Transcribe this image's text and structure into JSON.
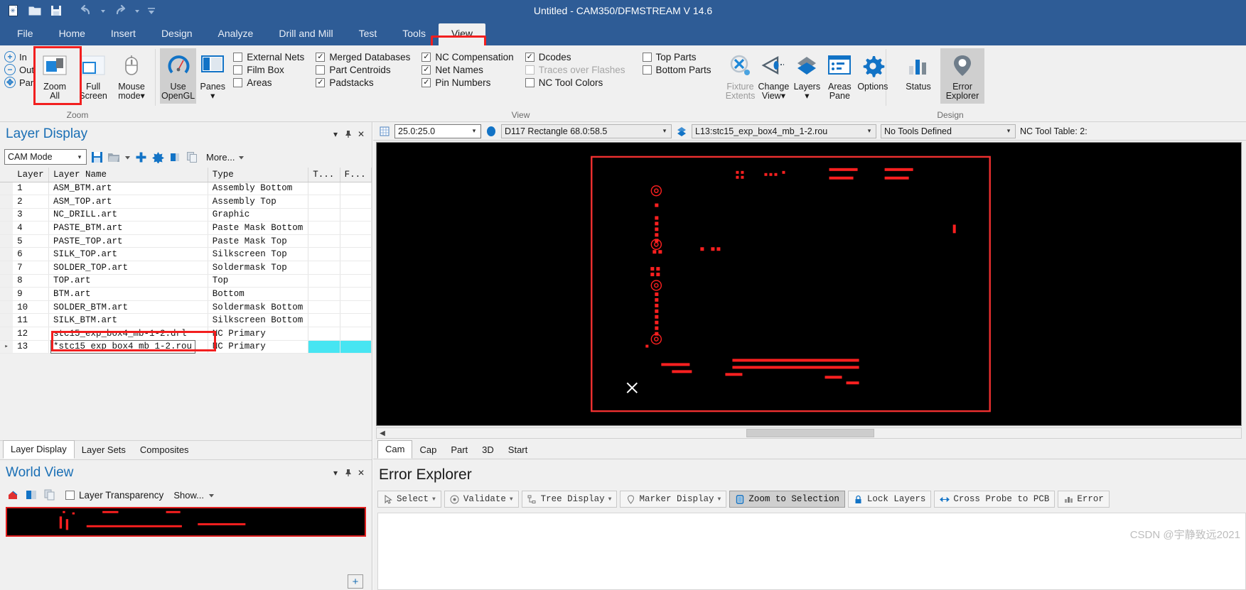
{
  "window": {
    "title": "Untitled - CAM350/DFMSTREAM V 14.6"
  },
  "quick_access": {
    "items": [
      {
        "name": "new-document-icon",
        "glyph": "new"
      },
      {
        "name": "open-folder-icon",
        "glyph": "open"
      },
      {
        "name": "save-icon",
        "glyph": "save"
      },
      {
        "name": "undo-icon",
        "glyph": "undo"
      },
      {
        "name": "undo-dropdown-icon",
        "glyph": "caret"
      },
      {
        "name": "redo-icon",
        "glyph": "redo"
      },
      {
        "name": "redo-dropdown-icon",
        "glyph": "caret"
      },
      {
        "name": "customize-qat-icon",
        "glyph": "caret"
      }
    ]
  },
  "ribbon_tabs": [
    {
      "label": "File",
      "active": false
    },
    {
      "label": "Home",
      "active": false
    },
    {
      "label": "Insert",
      "active": false
    },
    {
      "label": "Design",
      "active": false
    },
    {
      "label": "Analyze",
      "active": false
    },
    {
      "label": "Drill and Mill",
      "active": false
    },
    {
      "label": "Test",
      "active": false
    },
    {
      "label": "Tools",
      "active": false
    },
    {
      "label": "View",
      "active": true
    }
  ],
  "ribbon": {
    "zoom_group": {
      "label": "Zoom",
      "small_items": [
        {
          "label": "In",
          "icon": "zoom-in-icon"
        },
        {
          "label": "Out",
          "icon": "zoom-out-icon"
        },
        {
          "label": "Pan",
          "icon": "pan-icon"
        }
      ],
      "buttons": [
        {
          "label": "Zoom\nAll",
          "icon": "zoom-all-icon",
          "highlighted": true
        },
        {
          "label": "Full\nScreen",
          "icon": "full-screen-icon",
          "highlighted": false
        },
        {
          "label": "Mouse\nmode▾",
          "icon": "mouse-mode-icon",
          "highlighted": false
        }
      ]
    },
    "view_group": {
      "label": "View",
      "buttons": [
        {
          "label": "Use\nOpenGL",
          "icon": "opengl-icon",
          "selected": true
        },
        {
          "label": "Panes\n▾",
          "icon": "panes-icon",
          "selected": false
        }
      ],
      "checkbox_columns": [
        [
          {
            "label": "External Nets",
            "checked": false,
            "disabled": false
          },
          {
            "label": "Film Box",
            "checked": false,
            "disabled": false
          },
          {
            "label": "Areas",
            "checked": false,
            "disabled": false
          }
        ],
        [
          {
            "label": "Merged Databases",
            "checked": true,
            "disabled": false
          },
          {
            "label": "Part Centroids",
            "checked": false,
            "disabled": false
          },
          {
            "label": "Padstacks",
            "checked": true,
            "disabled": false
          }
        ],
        [
          {
            "label": "NC Compensation",
            "checked": true,
            "disabled": false
          },
          {
            "label": "Net Names",
            "checked": true,
            "disabled": false
          },
          {
            "label": "Pin Numbers",
            "checked": true,
            "disabled": false
          }
        ],
        [
          {
            "label": "Dcodes",
            "checked": true,
            "disabled": false
          },
          {
            "label": "Traces over Flashes",
            "checked": false,
            "disabled": true
          },
          {
            "label": "NC Tool Colors",
            "checked": false,
            "disabled": false
          }
        ],
        [
          {
            "label": "Top Parts",
            "checked": false,
            "disabled": false
          },
          {
            "label": "Bottom Parts",
            "checked": false,
            "disabled": false
          }
        ]
      ],
      "big_buttons": [
        {
          "label": "Fixture\nExtents",
          "icon": "fixture-extents-icon",
          "disabled": true
        },
        {
          "label": "Change\nView▾",
          "icon": "change-view-icon",
          "disabled": false
        },
        {
          "label": "Layers\n▾",
          "icon": "layers-icon",
          "disabled": false
        },
        {
          "label": "Areas\nPane",
          "icon": "areas-pane-icon",
          "disabled": false
        },
        {
          "label": "Options",
          "icon": "options-gear-icon",
          "disabled": false
        }
      ]
    },
    "design_group": {
      "label": "Design",
      "buttons": [
        {
          "label": "Status",
          "icon": "status-chart-icon",
          "selected": false
        },
        {
          "label": "Error\nExplorer",
          "icon": "error-explorer-pin-icon",
          "selected": true
        }
      ]
    }
  },
  "doc_toolbar": {
    "grid_icon": "grid-icon",
    "grid_value": "25.0:25.0",
    "dcode_icon": "dcode-icon",
    "dcode_value": "D117 Rectangle 68.0:58.5",
    "layer_icon": "layer-icon",
    "layer_value": "L13:stc15_exp_box4_mb_1-2.rou",
    "tools_value": "No Tools Defined",
    "nc_tool_table": "NC Tool Table: 2:"
  },
  "layer_display": {
    "title": "Layer Display",
    "panel_buttons": [
      {
        "name": "collapse-icon",
        "glyph": "▾"
      },
      {
        "name": "pin-icon",
        "glyph": "📌"
      },
      {
        "name": "close-icon",
        "glyph": "✕"
      }
    ],
    "mode": "CAM Mode",
    "toolbar_icons": [
      {
        "name": "save-layers-icon"
      },
      {
        "name": "open-layers-icon"
      },
      {
        "name": "open-layers-dropdown-icon"
      },
      {
        "name": "add-layer-icon"
      },
      {
        "name": "delete-layer-icon"
      },
      {
        "name": "import-layer-icon"
      },
      {
        "name": "copy-layer-icon"
      }
    ],
    "more_label": "More...",
    "columns": [
      "Layer",
      "Layer Name",
      "Type",
      "T...",
      "F..."
    ],
    "rows": [
      {
        "num": "1",
        "name": "ASM_BTM.art",
        "type": "Assembly Bottom",
        "t": "",
        "f": ""
      },
      {
        "num": "2",
        "name": "ASM_TOP.art",
        "type": "Assembly Top",
        "t": "",
        "f": ""
      },
      {
        "num": "3",
        "name": "NC_DRILL.art",
        "type": "Graphic",
        "t": "",
        "f": ""
      },
      {
        "num": "4",
        "name": "PASTE_BTM.art",
        "type": "Paste Mask Bottom",
        "t": "",
        "f": ""
      },
      {
        "num": "5",
        "name": "PASTE_TOP.art",
        "type": "Paste Mask Top",
        "t": "",
        "f": ""
      },
      {
        "num": "6",
        "name": "SILK_TOP.art",
        "type": "Silkscreen Top",
        "t": "",
        "f": ""
      },
      {
        "num": "7",
        "name": "SOLDER_TOP.art",
        "type": "Soldermask Top",
        "t": "",
        "f": ""
      },
      {
        "num": "8",
        "name": "TOP.art",
        "type": "Top",
        "t": "",
        "f": ""
      },
      {
        "num": "9",
        "name": "BTM.art",
        "type": "Bottom",
        "t": "",
        "f": ""
      },
      {
        "num": "10",
        "name": "SOLDER_BTM.art",
        "type": "Soldermask Bottom",
        "t": "",
        "f": ""
      },
      {
        "num": "11",
        "name": "SILK_BTM.art",
        "type": "Silkscreen Bottom",
        "t": "",
        "f": ""
      },
      {
        "num": "12",
        "name": "stc15_exp_box4_mb-1-2.drl",
        "type": "NC Primary",
        "t": "",
        "f": ""
      },
      {
        "num": "13",
        "name": "*stc15_exp_box4_mb_1-2.rou",
        "type": "NC Primary",
        "t": "",
        "f": "",
        "editing": true,
        "highlight": true
      }
    ],
    "tabs": [
      {
        "label": "Layer Display",
        "active": true
      },
      {
        "label": "Layer Sets",
        "active": false
      },
      {
        "label": "Composites",
        "active": false
      }
    ]
  },
  "world_view": {
    "title": "World View",
    "transparency_label": "Layer Transparency",
    "transparency_checked": false,
    "show_label": "Show...",
    "icons": [
      {
        "name": "world-view-home-icon"
      },
      {
        "name": "world-view-fit-icon"
      },
      {
        "name": "world-view-copy-icon"
      }
    ],
    "zoom_plus": "+"
  },
  "cam_tabs": [
    {
      "label": "Cam",
      "active": true
    },
    {
      "label": "Cap",
      "active": false
    },
    {
      "label": "Part",
      "active": false
    },
    {
      "label": "3D",
      "active": false
    },
    {
      "label": "Start",
      "active": false
    }
  ],
  "error_explorer": {
    "title": "Error Explorer",
    "buttons": [
      {
        "label": "Select",
        "icon": "cursor-icon",
        "caret": true,
        "selected": false
      },
      {
        "label": "Validate",
        "icon": "validate-icon",
        "caret": true,
        "selected": false
      },
      {
        "label": "Tree Display",
        "icon": "tree-icon",
        "caret": true,
        "selected": false
      },
      {
        "label": "Marker Display",
        "icon": "marker-icon",
        "caret": true,
        "selected": false
      },
      {
        "label": "Zoom to Selection",
        "icon": "zoom-selection-icon",
        "caret": false,
        "selected": true
      },
      {
        "label": "Lock Layers",
        "icon": "lock-icon",
        "caret": false,
        "selected": false
      },
      {
        "label": "Cross Probe to PCB",
        "icon": "cross-probe-icon",
        "caret": false,
        "selected": false
      },
      {
        "label": "Error",
        "icon": "error-chart-icon",
        "caret": false,
        "selected": false
      }
    ]
  },
  "watermark": "CSDN @宇静致远2021",
  "colors": {
    "titlebar": "#2e5c96",
    "accent_blue": "#1a6fb5",
    "highlight_red": "#f21f1f",
    "cad_background": "#000000",
    "board_outline": "#f03030",
    "trace_red": "#ff2020",
    "cyan_cell": "#47e5f2"
  }
}
